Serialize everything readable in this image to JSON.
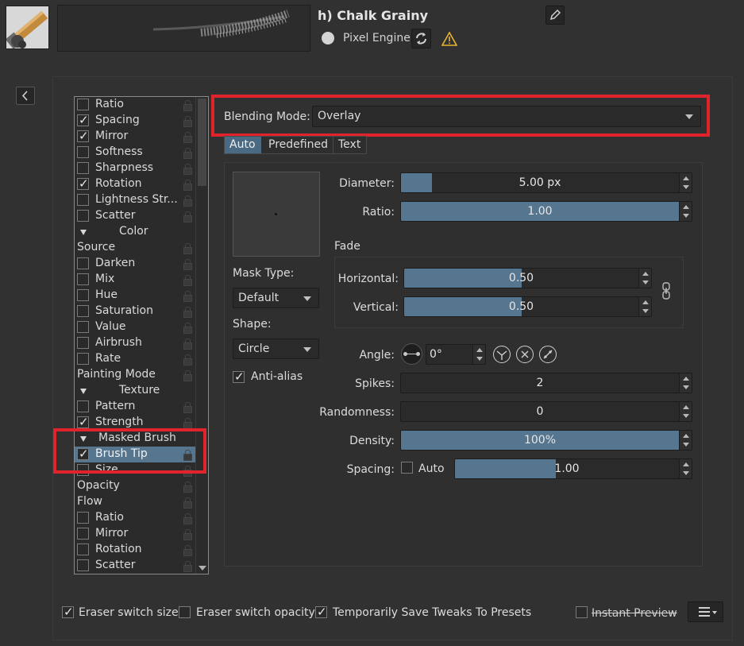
{
  "preset": {
    "name": "h) Chalk Grainy",
    "engine": "Pixel Engine"
  },
  "option_list": [
    {
      "label": "Ratio",
      "type": "check",
      "checked": false
    },
    {
      "label": "Spacing",
      "type": "check",
      "checked": true
    },
    {
      "label": "Mirror",
      "type": "check",
      "checked": true
    },
    {
      "label": "Softness",
      "type": "check",
      "checked": false
    },
    {
      "label": "Sharpness",
      "type": "check",
      "checked": false
    },
    {
      "label": "Rotation",
      "type": "check",
      "checked": true
    },
    {
      "label": "Lightness Str...",
      "type": "check",
      "checked": false
    },
    {
      "label": "Scatter",
      "type": "check",
      "checked": false
    },
    {
      "label": "Color",
      "type": "group"
    },
    {
      "label": "Source",
      "type": "plain"
    },
    {
      "label": "Darken",
      "type": "check",
      "checked": false
    },
    {
      "label": "Mix",
      "type": "check",
      "checked": false
    },
    {
      "label": "Hue",
      "type": "check",
      "checked": false
    },
    {
      "label": "Saturation",
      "type": "check",
      "checked": false
    },
    {
      "label": "Value",
      "type": "check",
      "checked": false
    },
    {
      "label": "Airbrush",
      "type": "check",
      "checked": false
    },
    {
      "label": "Rate",
      "type": "check",
      "checked": false
    },
    {
      "label": "Painting Mode",
      "type": "plain"
    },
    {
      "label": "Texture",
      "type": "group"
    },
    {
      "label": "Pattern",
      "type": "check",
      "checked": false
    },
    {
      "label": "Strength",
      "type": "check",
      "checked": true
    },
    {
      "label": "Masked Brush",
      "type": "group2"
    },
    {
      "label": "Brush Tip",
      "type": "check",
      "checked": true,
      "selected": true
    },
    {
      "label": "Size",
      "type": "check",
      "checked": false
    },
    {
      "label": "Opacity",
      "type": "plain"
    },
    {
      "label": "Flow",
      "type": "plain"
    },
    {
      "label": "Ratio",
      "type": "check",
      "checked": false
    },
    {
      "label": "Mirror",
      "type": "check",
      "checked": false
    },
    {
      "label": "Rotation",
      "type": "check",
      "checked": false
    },
    {
      "label": "Scatter",
      "type": "check",
      "checked": false
    }
  ],
  "blending": {
    "label": "Blending Mode:",
    "value": "Overlay"
  },
  "tabs": [
    "Auto",
    "Predefined",
    "Text"
  ],
  "mask": {
    "mask_type_label": "Mask Type:",
    "mask_type_value": "Default",
    "shape_label": "Shape:",
    "shape_value": "Circle",
    "antialias_label": "Anti-alias"
  },
  "params": {
    "diameter_label": "Diameter:",
    "diameter_value": "5.00 px",
    "diameter_fill": 0.11,
    "ratio_label": "Ratio:",
    "ratio_value": "1.00",
    "ratio_fill": 1.0,
    "fade_label": "Fade",
    "horizontal_label": "Horizontal:",
    "horizontal_value": "0.50",
    "horizontal_fill": 0.5,
    "vertical_label": "Vertical:",
    "vertical_value": "0.50",
    "vertical_fill": 0.5,
    "angle_label": "Angle:",
    "angle_value": "0°",
    "spikes_label": "Spikes:",
    "spikes_value": "2",
    "randomness_label": "Randomness:",
    "randomness_value": "0",
    "density_label": "Density:",
    "density_value": "100%",
    "density_fill": 1.0,
    "spacing_label": "Spacing:",
    "spacing_auto_label": "Auto",
    "spacing_value": "1.00",
    "spacing_fill": 0.45
  },
  "footer": {
    "eraser_size": "Eraser switch size",
    "eraser_opacity": "Eraser switch opacity",
    "save_tweaks": "Temporarily Save Tweaks To Presets",
    "instant_preview": "Instant Preview"
  },
  "colors": {
    "accent": "#56758f",
    "highlight": "#e1232b",
    "warning": "#e8b430"
  }
}
